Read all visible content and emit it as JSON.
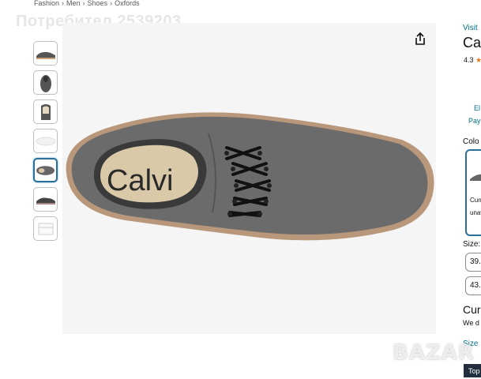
{
  "breadcrumb": [
    "Fashion",
    "Men",
    "Shoes",
    "Oxfords"
  ],
  "breadcrumb_sep": "›",
  "watermark_text": "Потребител 2539203",
  "thumbnails": [
    {
      "name": "thumb-side-view",
      "active": false
    },
    {
      "name": "thumb-front-view",
      "active": false
    },
    {
      "name": "thumb-back-view",
      "active": false
    },
    {
      "name": "thumb-sole-view",
      "active": false
    },
    {
      "name": "thumb-top-view",
      "active": true
    },
    {
      "name": "thumb-pair-view",
      "active": false
    },
    {
      "name": "thumb-box-view",
      "active": false
    }
  ],
  "main_image": {
    "icon": "share-icon",
    "brand_text": "Calvi"
  },
  "right_panel": {
    "visit": "Visit",
    "title": "Cal",
    "rating_value": "4.3",
    "rating_star": "★",
    "el_link": "El",
    "pay_link": "Pay",
    "color_label": "Colo",
    "swatch_line1": "Curr",
    "swatch_line2": "unav",
    "size_label": "Size:",
    "size_options": [
      "39.",
      "43."
    ],
    "currently_title": "Curr",
    "currently_sub": "We d",
    "size_guide": "Size",
    "top_button": "Top"
  },
  "colors": {
    "link": "#007185",
    "star": "#de7921",
    "selected_border": "#2a6f97",
    "top_bg": "#232f3e",
    "shoe_body": "#6b6b6b"
  },
  "overlay_logo": "BAZAR"
}
